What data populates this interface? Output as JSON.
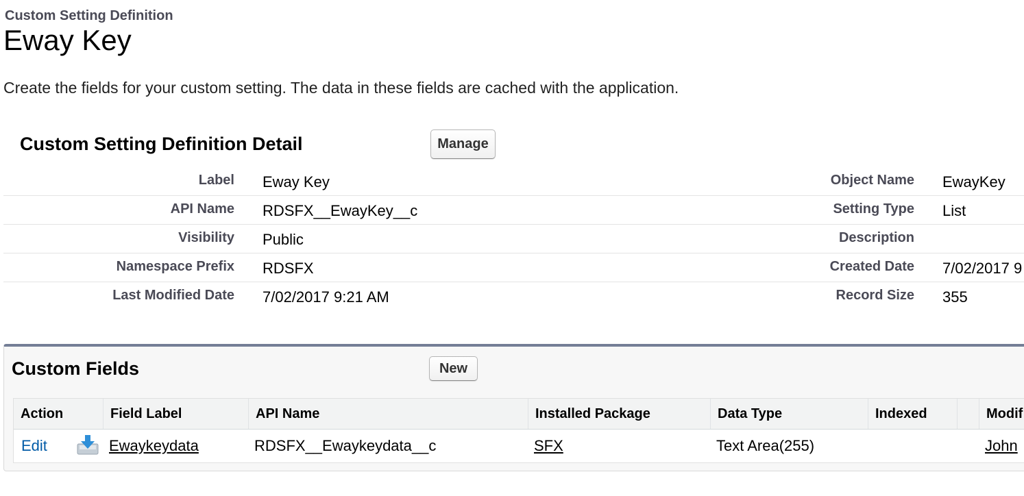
{
  "header": {
    "eyebrow": "Custom Setting Definition",
    "title": "Eway Key",
    "intro": "Create the fields for your custom setting. The data in these fields are cached with the application."
  },
  "detail": {
    "title": "Custom Setting Definition Detail",
    "manage_label": "Manage",
    "left": [
      {
        "label": "Label",
        "value": "Eway Key"
      },
      {
        "label": "API Name",
        "value": "RDSFX__EwayKey__c"
      },
      {
        "label": "Visibility",
        "value": "Public"
      },
      {
        "label": "Namespace Prefix",
        "value": "RDSFX"
      },
      {
        "label": "Last Modified Date",
        "value": "7/02/2017 9:21 AM"
      }
    ],
    "right": [
      {
        "label": "Object Name",
        "value": "EwayKey"
      },
      {
        "label": "Setting Type",
        "value": "List"
      },
      {
        "label": "Description",
        "value": ""
      },
      {
        "label": "Created Date",
        "value": "7/02/2017 9"
      },
      {
        "label": "Record Size",
        "value": "355"
      }
    ]
  },
  "custom_fields": {
    "title": "Custom Fields",
    "new_label": "New",
    "columns": [
      "Action",
      "Field Label",
      "API Name",
      "Installed Package",
      "Data Type",
      "Indexed",
      "",
      "Modif"
    ],
    "rows": [
      {
        "action": "Edit",
        "icon": "package-install-icon",
        "field_label": "Ewaykeydata",
        "api_name": "RDSFX__Ewaykeydata__c",
        "installed_package": "SFX",
        "data_type": "Text Area(255)",
        "indexed": "",
        "modified_by": "John"
      }
    ]
  },
  "colors": {
    "label_gray": "#4a4a56",
    "panel_border_top": "#747e96",
    "link_blue": "#015ba7"
  }
}
